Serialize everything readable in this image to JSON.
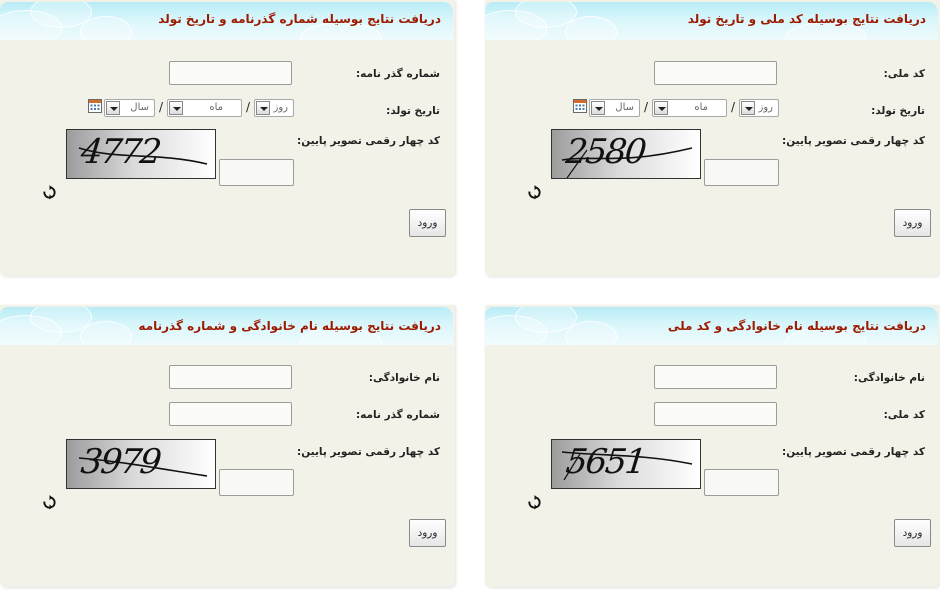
{
  "panels": {
    "national_birth": {
      "title": "دریافت نتایج بوسیله کد ملی و تاریخ تولد",
      "field1_label": "کد ملی:",
      "birth_label": "تاریخ تولد:",
      "day_placeholder": "روز",
      "month_placeholder": "ماه",
      "year_placeholder": "سال",
      "slash": "/",
      "captcha_label": "کد چهار رقمی تصویر پایین:",
      "captcha_text": "2580",
      "submit": "ورود"
    },
    "passport_birth": {
      "title": "دریافت نتایج بوسیله شماره گذرنامه و تاریخ تولد",
      "field1_label": "شماره گذر نامه:",
      "birth_label": "تاریخ تولد:",
      "day_placeholder": "روز",
      "month_placeholder": "ماه",
      "year_placeholder": "سال",
      "slash": "/",
      "captcha_label": "کد چهار رقمی تصویر پایین:",
      "captcha_text": "4772",
      "submit": "ورود"
    },
    "family_national": {
      "title": "دریافت نتایج بوسیله نام خانوادگی و کد ملی",
      "field1_label": "نام خانوادگی:",
      "field2_label": "کد ملی:",
      "captcha_label": "کد چهار رقمی تصویر پایین:",
      "captcha_text": "5651",
      "submit": "ورود"
    },
    "family_passport": {
      "title": "دریافت نتایج بوسیله نام خانوادگی و شماره گذرنامه",
      "field1_label": "نام خانوادگی:",
      "field2_label": "شماره گذر نامه:",
      "captcha_label": "کد چهار رقمی تصویر پایین:",
      "captcha_text": "3979",
      "submit": "ورود"
    }
  },
  "icons": {
    "refresh": "refresh-icon",
    "calendar": "calendar-icon",
    "dropdown": "chevron-down-icon"
  },
  "colors": {
    "title": "#9c1b00",
    "panel_bg": "#f3f2e8",
    "header_bg": "#c7f0f8"
  }
}
